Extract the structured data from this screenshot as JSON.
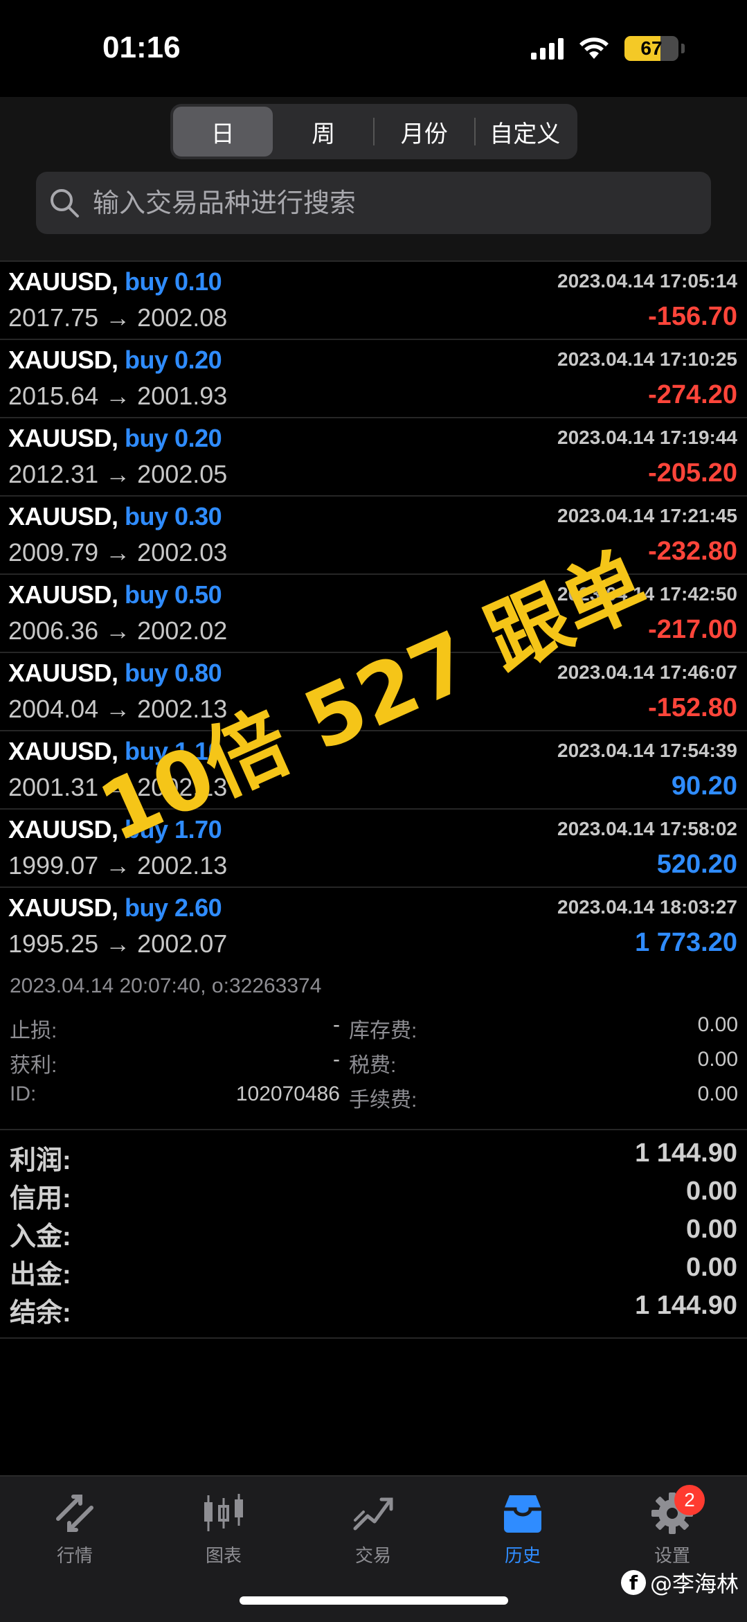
{
  "status_bar": {
    "time": "01:16",
    "battery": "67"
  },
  "period_tabs": [
    {
      "label": "日",
      "active": true
    },
    {
      "label": "周",
      "active": false
    },
    {
      "label": "月份",
      "active": false
    },
    {
      "label": "自定义",
      "active": false
    }
  ],
  "search": {
    "placeholder": "输入交易品种进行搜索"
  },
  "trades": [
    {
      "symbol": "XAUUSD,",
      "side": "buy 0.10",
      "open": "2017.75",
      "arrow": "→",
      "close": "2002.08",
      "time": "2023.04.14 17:05:14",
      "profit": "-156.70",
      "sign": "neg"
    },
    {
      "symbol": "XAUUSD,",
      "side": "buy 0.20",
      "open": "2015.64",
      "arrow": "→",
      "close": "2001.93",
      "time": "2023.04.14 17:10:25",
      "profit": "-274.20",
      "sign": "neg"
    },
    {
      "symbol": "XAUUSD,",
      "side": "buy 0.20",
      "open": "2012.31",
      "arrow": "→",
      "close": "2002.05",
      "time": "2023.04.14 17:19:44",
      "profit": "-205.20",
      "sign": "neg"
    },
    {
      "symbol": "XAUUSD,",
      "side": "buy 0.30",
      "open": "2009.79",
      "arrow": "→",
      "close": "2002.03",
      "time": "2023.04.14 17:21:45",
      "profit": "-232.80",
      "sign": "neg"
    },
    {
      "symbol": "XAUUSD,",
      "side": "buy 0.50",
      "open": "2006.36",
      "arrow": "→",
      "close": "2002.02",
      "time": "2023.04.14 17:42:50",
      "profit": "-217.00",
      "sign": "neg"
    },
    {
      "symbol": "XAUUSD,",
      "side": "buy 0.80",
      "open": "2004.04",
      "arrow": "→",
      "close": "2002.13",
      "time": "2023.04.14 17:46:07",
      "profit": "-152.80",
      "sign": "neg"
    },
    {
      "symbol": "XAUUSD,",
      "side": "buy 1.10",
      "open": "2001.31",
      "arrow": "→",
      "close": "2002.13",
      "time": "2023.04.14 17:54:39",
      "profit": "90.20",
      "sign": "pos"
    },
    {
      "symbol": "XAUUSD,",
      "side": "buy 1.70",
      "open": "1999.07",
      "arrow": "→",
      "close": "2002.13",
      "time": "2023.04.14 17:58:02",
      "profit": "520.20",
      "sign": "pos"
    },
    {
      "symbol": "XAUUSD,",
      "side": "buy 2.60",
      "open": "1995.25",
      "arrow": "→",
      "close": "2002.07",
      "time": "2023.04.14 18:03:27",
      "profit": "1 773.20",
      "sign": "pos"
    }
  ],
  "detail": {
    "timestamp": "2023.04.14 20:07:40, o:32263374",
    "rows": [
      {
        "label1": "止损:",
        "value1": "-",
        "label2": "库存费:",
        "value2": "0.00"
      },
      {
        "label1": "获利:",
        "value1": "-",
        "label2": "税费:",
        "value2": "0.00"
      },
      {
        "label1": "ID:",
        "value1": "102070486",
        "label2": "手续费:",
        "value2": "0.00"
      }
    ]
  },
  "summary": [
    {
      "label": "利润:",
      "value": "1 144.90"
    },
    {
      "label": "信用:",
      "value": "0.00"
    },
    {
      "label": "入金:",
      "value": "0.00"
    },
    {
      "label": "出金:",
      "value": "0.00"
    },
    {
      "label": "结余:",
      "value": "1 144.90"
    }
  ],
  "watermark": "10倍 527 跟单",
  "tabs": [
    {
      "label": "行情",
      "icon": "quotes-icon",
      "active": false
    },
    {
      "label": "图表",
      "icon": "chart-icon",
      "active": false
    },
    {
      "label": "交易",
      "icon": "trade-icon",
      "active": false
    },
    {
      "label": "历史",
      "icon": "history-icon",
      "active": true
    },
    {
      "label": "设置",
      "icon": "settings-icon",
      "active": false,
      "badge": "2"
    }
  ],
  "credit": {
    "logo": "f",
    "text": "@李海林"
  },
  "colors": {
    "accent": "#2f8cff",
    "loss": "#ff453a",
    "watermark": "#f5c518",
    "battery": "#f4c926"
  }
}
